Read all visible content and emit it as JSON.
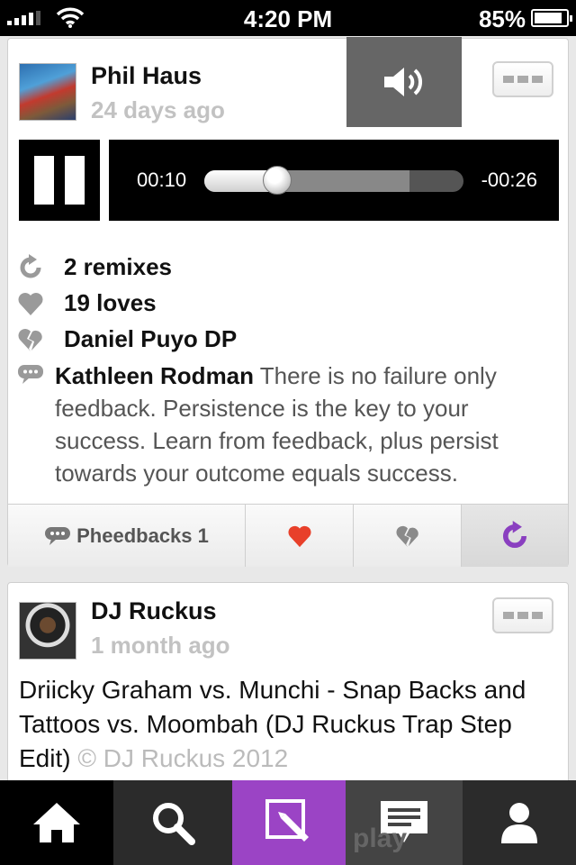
{
  "status_bar": {
    "time": "4:20 PM",
    "battery_percent": "85%",
    "signal_bars": 4,
    "battery_level": 0.85
  },
  "posts": [
    {
      "user_name": "Phil Haus",
      "time_ago": "24 days ago",
      "player": {
        "elapsed": "00:10",
        "remaining": "-00:26",
        "played_fraction": 0.28,
        "buffered_fraction": 0.79
      },
      "stats": {
        "remixes": "2 remixes",
        "loves": "19 loves",
        "hater": "Daniel Puyo DP"
      },
      "comment": {
        "author": "Kathleen Rodman",
        "text": "There is no failure only feedback.  Persistence is the key to your success. Learn from feedback, plus persist towards your outcome equals success."
      },
      "actions": {
        "feedback_label": "Pheedbacks 1"
      }
    },
    {
      "user_name": "DJ Ruckus",
      "time_ago": "1 month ago",
      "track_title": "Driicky Graham vs. Munchi - Snap Backs and Tattoos vs. Moombah (DJ Ruckus Trap Step Edit)",
      "copyright": "© DJ Ruckus 2012"
    }
  ],
  "tab_bar": {
    "ghost_text": "play"
  },
  "colors": {
    "accent_purple": "#9b44c5",
    "love_red": "#e8402a",
    "remix_purple": "#8a3fc0"
  }
}
